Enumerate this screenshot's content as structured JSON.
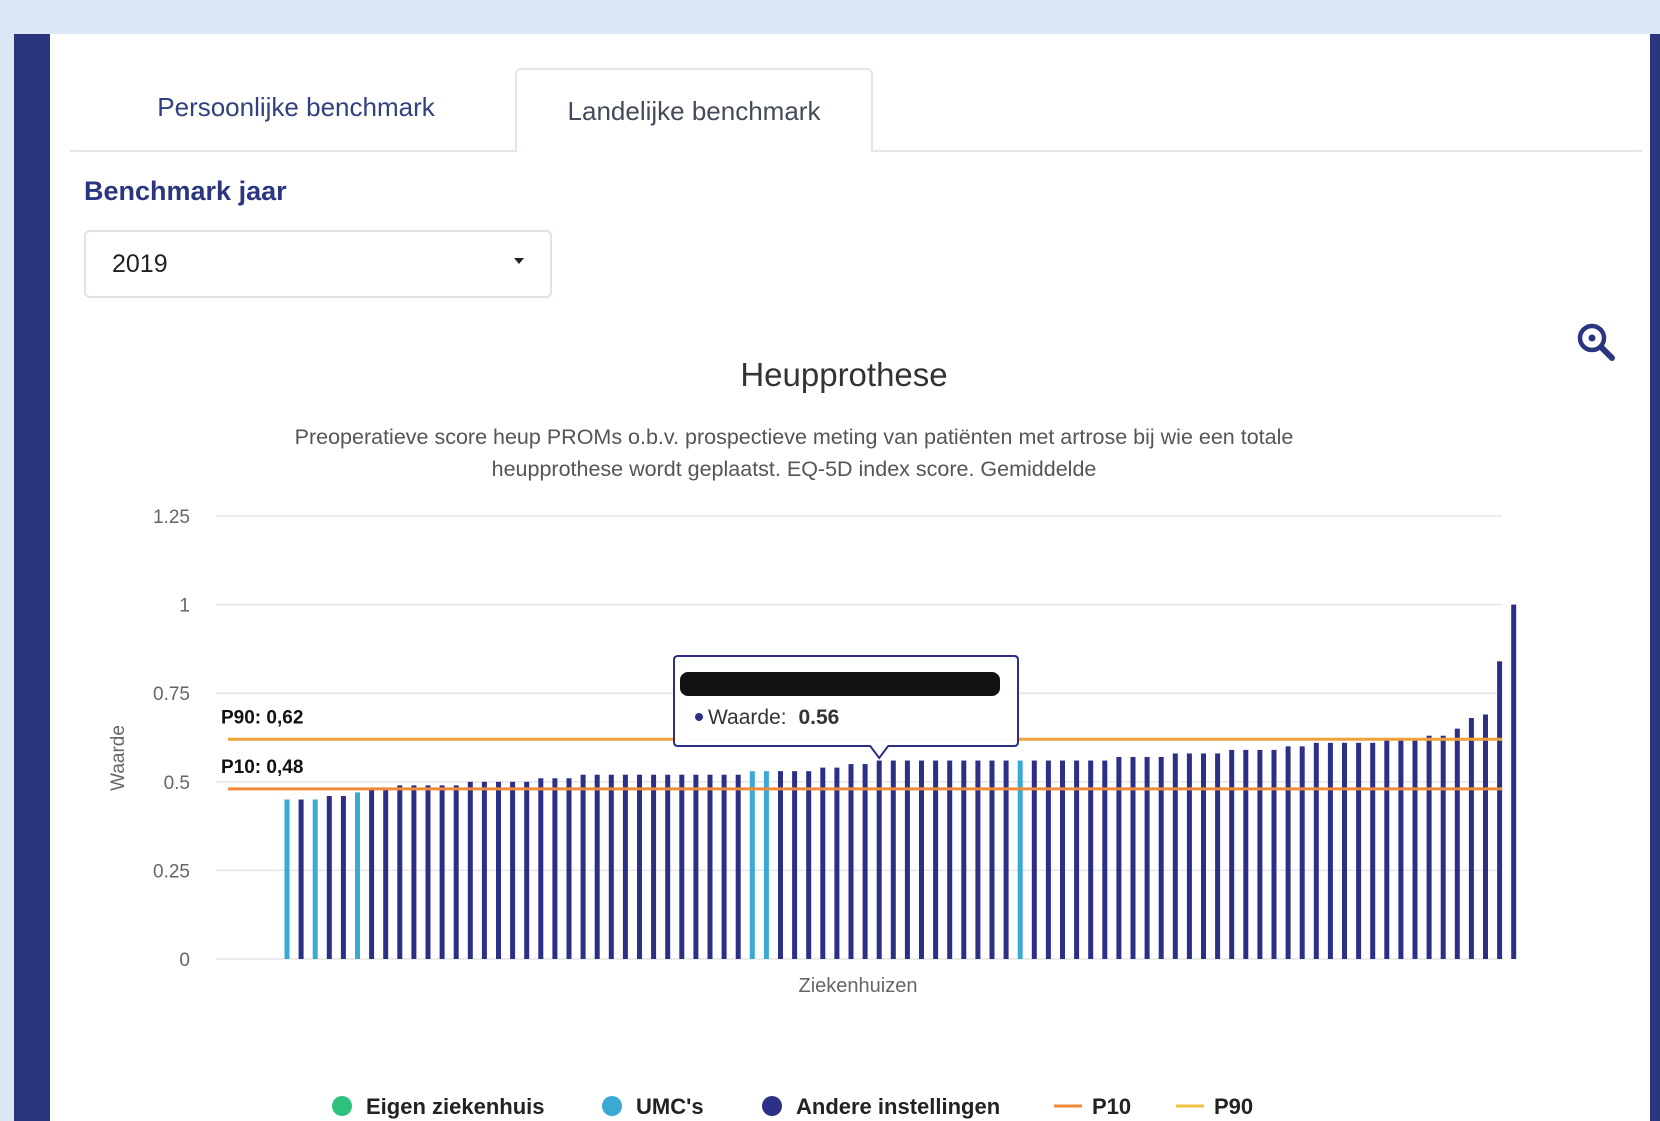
{
  "tabs": {
    "personal": "Persoonlijke benchmark",
    "national": "Landelijke benchmark"
  },
  "year": {
    "label": "Benchmark jaar",
    "selected": "2019"
  },
  "icons": {
    "zoom": "zoom-in-icon",
    "dropdown": "caret-down-icon"
  },
  "colors": {
    "eigen": "#2ec27e",
    "umc": "#3aa9d4",
    "andere": "#2c2f86",
    "p10": "#ef8a3a",
    "p90": "#f0c342",
    "brand": "#2c3680"
  },
  "chart_data": {
    "type": "bar",
    "title": "Heupprothese",
    "subtitle_lines": [
      "Preoperatieve score heup PROMs o.b.v. prospectieve meting van patiënten met artrose bij wie een totale",
      "heupprothese wordt geplaatst. EQ-5D index score. Gemiddelde"
    ],
    "ylabel": "Waarde",
    "xlabel": "Ziekenhuizen",
    "ylim": [
      0,
      1.25
    ],
    "yticks": [
      0,
      0.25,
      0.5,
      0.75,
      1,
      1.25
    ],
    "ytick_labels": [
      "0",
      "0.25",
      "0.5",
      "0.75",
      "1",
      "1.25"
    ],
    "grid": true,
    "values": [
      0.45,
      0.45,
      0.45,
      0.46,
      0.46,
      0.47,
      0.48,
      0.48,
      0.49,
      0.49,
      0.49,
      0.49,
      0.49,
      0.5,
      0.5,
      0.5,
      0.5,
      0.5,
      0.51,
      0.51,
      0.51,
      0.52,
      0.52,
      0.52,
      0.52,
      0.52,
      0.52,
      0.52,
      0.52,
      0.52,
      0.52,
      0.52,
      0.52,
      0.53,
      0.53,
      0.53,
      0.53,
      0.53,
      0.54,
      0.54,
      0.55,
      0.55,
      0.56,
      0.56,
      0.56,
      0.56,
      0.56,
      0.56,
      0.56,
      0.56,
      0.56,
      0.56,
      0.56,
      0.56,
      0.56,
      0.56,
      0.56,
      0.56,
      0.56,
      0.57,
      0.57,
      0.57,
      0.57,
      0.58,
      0.58,
      0.58,
      0.58,
      0.59,
      0.59,
      0.59,
      0.59,
      0.6,
      0.6,
      0.61,
      0.61,
      0.61,
      0.61,
      0.61,
      0.62,
      0.62,
      0.62,
      0.63,
      0.63,
      0.65,
      0.68,
      0.69,
      0.84,
      1.0
    ],
    "categories_type": [
      "umc",
      "andere",
      "umc",
      "andere",
      "andere",
      "umc",
      "andere",
      "andere",
      "andere",
      "andere",
      "andere",
      "andere",
      "andere",
      "andere",
      "andere",
      "andere",
      "andere",
      "andere",
      "andere",
      "andere",
      "andere",
      "andere",
      "andere",
      "andere",
      "andere",
      "andere",
      "andere",
      "andere",
      "andere",
      "andere",
      "andere",
      "andere",
      "andere",
      "umc",
      "umc",
      "andere",
      "andere",
      "andere",
      "andere",
      "andere",
      "andere",
      "andere",
      "andere",
      "andere",
      "andere",
      "andere",
      "andere",
      "andere",
      "andere",
      "andere",
      "andere",
      "andere",
      "umc",
      "andere",
      "andere",
      "andere",
      "andere",
      "andere",
      "andere",
      "andere",
      "andere",
      "andere",
      "andere",
      "andere",
      "andere",
      "andere",
      "andere",
      "andere",
      "andere",
      "andere",
      "andere",
      "andere",
      "andere",
      "andere",
      "andere",
      "andere",
      "andere",
      "andere",
      "andere",
      "andere",
      "andere",
      "andere",
      "andere",
      "andere",
      "andere",
      "andere",
      "andere",
      "andere"
    ],
    "reference_lines": [
      {
        "name": "P90",
        "value": 0.62,
        "label": "P90: 0,62",
        "color": "#f0a23a"
      },
      {
        "name": "P10",
        "value": 0.48,
        "label": "P10: 0,48",
        "color": "#ef8a3a"
      }
    ],
    "tooltip": {
      "index": 42,
      "series_label": "Waarde:",
      "value_label": "0.56"
    },
    "legend": {
      "placement": "bottom",
      "items": [
        {
          "label": "Eigen ziekenhuis",
          "kind": "dot",
          "color": "#2ec27e"
        },
        {
          "label": "UMC's",
          "kind": "dot",
          "color": "#3aa9d4"
        },
        {
          "label": "Andere instellingen",
          "kind": "dot",
          "color": "#2c2f86"
        },
        {
          "label": "P10",
          "kind": "line",
          "color": "#ef8a3a"
        },
        {
          "label": "P90",
          "kind": "line",
          "color": "#f0c342"
        }
      ]
    }
  }
}
